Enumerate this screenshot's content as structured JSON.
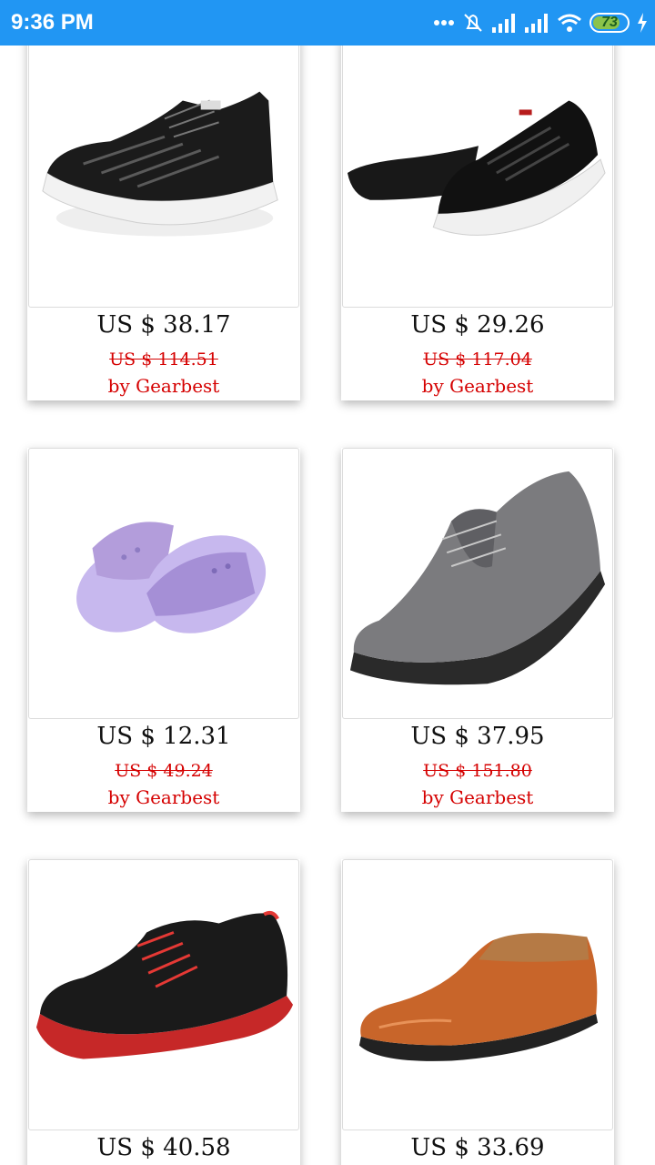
{
  "status_bar": {
    "time": "9:36 PM",
    "battery": "73",
    "icons": [
      "more-dots-icon",
      "alarm-off-icon",
      "signal-icon",
      "signal-icon",
      "wifi-icon",
      "battery-icon",
      "charging-icon"
    ]
  },
  "products": [
    {
      "price": "US $ 38.17",
      "old_price": "US $ 114.51",
      "seller": "by Gearbest",
      "image": "black-mesh-sneaker"
    },
    {
      "price": "US $ 29.26",
      "old_price": "US $ 117.04",
      "seller": "by Gearbest",
      "image": "black-running-shoe"
    },
    {
      "price": "US $ 12.31",
      "old_price": "US $ 49.24",
      "seller": "by Gearbest",
      "image": "purple-slide-sandals"
    },
    {
      "price": "US $ 37.95",
      "old_price": "US $ 151.80",
      "seller": "by Gearbest",
      "image": "gray-suede-sneaker"
    },
    {
      "price": "US $ 40.58",
      "old_price": "",
      "seller": "",
      "image": "black-red-hiking-shoe"
    },
    {
      "price": "US $ 33.69",
      "old_price": "",
      "seller": "",
      "image": "brown-leather-loafer"
    }
  ],
  "colors": {
    "status_bar": "#2196f3",
    "sale_red": "#d50000"
  }
}
